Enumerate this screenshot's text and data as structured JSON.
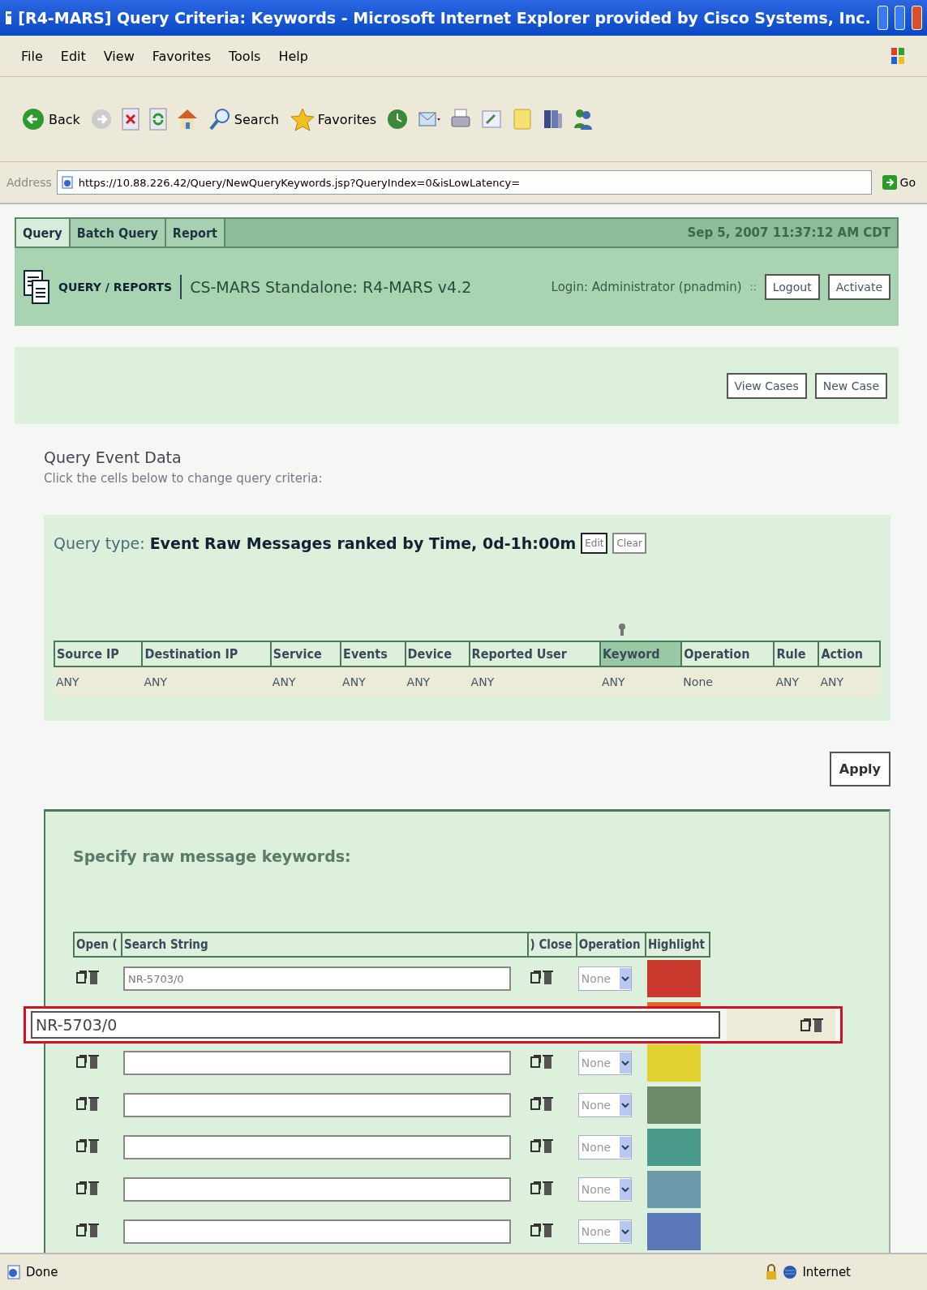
{
  "window": {
    "title": "[R4-MARS] Query Criteria: Keywords - Microsoft Internet Explorer provided by Cisco Systems, Inc."
  },
  "menu": [
    "File",
    "Edit",
    "View",
    "Favorites",
    "Tools",
    "Help"
  ],
  "toolbar": [
    {
      "kind": "back",
      "label": "Back"
    },
    {
      "kind": "forward"
    },
    {
      "kind": "stop"
    },
    {
      "kind": "refresh"
    },
    {
      "kind": "home"
    },
    {
      "kind": "search",
      "label": "Search"
    },
    {
      "kind": "favorites",
      "label": "Favorites"
    },
    {
      "kind": "history"
    },
    {
      "kind": "mail"
    },
    {
      "kind": "print"
    },
    {
      "kind": "edit"
    },
    {
      "kind": "note"
    },
    {
      "kind": "research"
    },
    {
      "kind": "messenger"
    }
  ],
  "address": {
    "label": "Address",
    "url": "https://10.88.226.42/Query/NewQueryKeywords.jsp?QueryIndex=0&isLowLatency=",
    "go": "Go"
  },
  "nav": {
    "tabs": [
      {
        "label": "Query",
        "selected": true
      },
      {
        "label": "Batch Query",
        "selected": false
      },
      {
        "label": "Report",
        "selected": false
      }
    ],
    "datetime": "Sep 5, 2007 11:37:12 AM CDT"
  },
  "header": {
    "section": "QUERY / REPORTS",
    "product": "CS-MARS Standalone: R4-MARS v4.2",
    "login": "Login: Administrator (pnadmin)",
    "separator": "::",
    "buttons": [
      "Logout",
      "Activate"
    ]
  },
  "case_buttons": [
    "View Cases",
    "New Case"
  ],
  "query": {
    "title": "Query Event Data",
    "hint": "Click the cells below to change query criteria:",
    "type_label": "Query type:",
    "type_value": "Event Raw Messages ranked by Time, 0d-1h:00m",
    "buttons": [
      "Edit",
      "Clear"
    ],
    "columns": [
      {
        "label": "Source IP",
        "selected": false
      },
      {
        "label": "Destination IP",
        "selected": false
      },
      {
        "label": "Service",
        "selected": false
      },
      {
        "label": "Events",
        "selected": false
      },
      {
        "label": "Device",
        "selected": false
      },
      {
        "label": "Reported User",
        "selected": false
      },
      {
        "label": "Keyword",
        "selected": true
      },
      {
        "label": "Operation",
        "selected": false
      },
      {
        "label": "Rule",
        "selected": false
      },
      {
        "label": "Action",
        "selected": false
      }
    ],
    "values": [
      "ANY",
      "ANY",
      "ANY",
      "ANY",
      "ANY",
      "ANY",
      "ANY",
      "None",
      "ANY",
      "ANY"
    ]
  },
  "apply": "Apply",
  "keywords": {
    "title": "Specify raw message keywords:",
    "columns": [
      "Open (",
      "Search String",
      ") Close",
      "Operation",
      "Highlight"
    ],
    "rows": [
      {
        "value": "NR-5703/0",
        "operation": "None",
        "color": "#c8382c"
      },
      {
        "color": "#e0662a"
      },
      {
        "value": "",
        "operation": "None",
        "color": "#e2d230"
      },
      {
        "value": "",
        "operation": "None",
        "color": "#6c8a6a"
      },
      {
        "value": "",
        "operation": "None",
        "color": "#4a9a8c"
      },
      {
        "value": "",
        "operation": "None",
        "color": "#6c9aaa"
      },
      {
        "value": "",
        "operation": "None",
        "color": "#5a78b8"
      }
    ]
  },
  "callout": {
    "value": "NR-5703/0"
  },
  "status": {
    "text": "Done",
    "zone": "Internet"
  }
}
